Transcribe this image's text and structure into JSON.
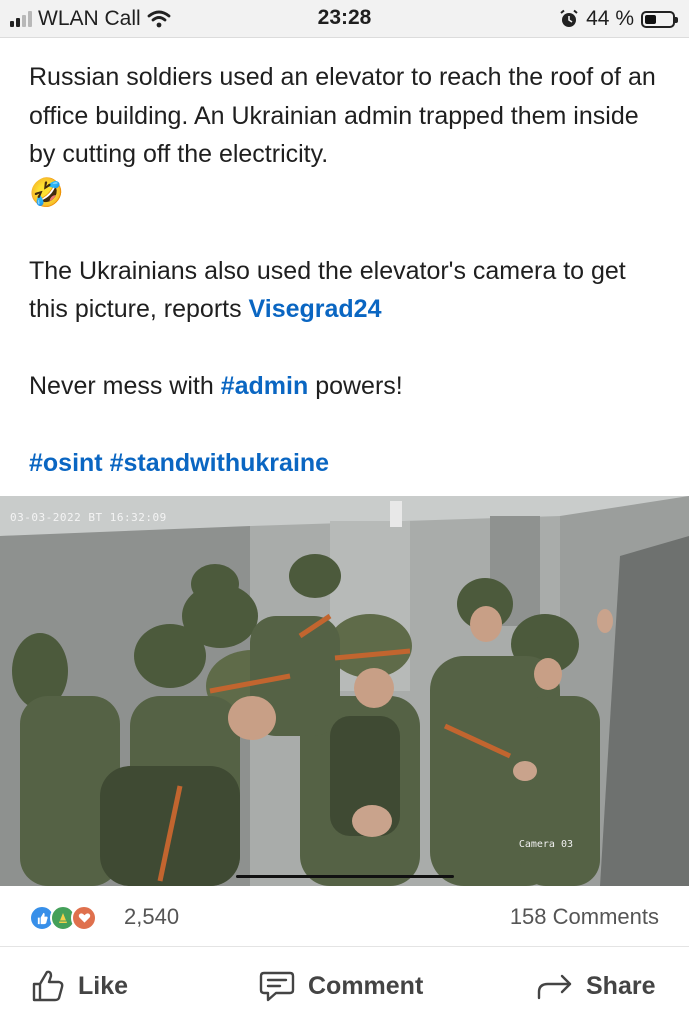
{
  "status_bar": {
    "carrier": "WLAN Call",
    "time": "23:28",
    "battery_percent": "44 %",
    "battery_level": 0.44,
    "signal_bars_active": 2,
    "icons": [
      "signal-icon",
      "wifi-icon",
      "alarm-icon",
      "battery-icon"
    ]
  },
  "post": {
    "paragraph_1": "Russian soldiers used an elevator to reach the roof of an office building. An Ukrainian admin trapped them inside by cutting off the electricity.",
    "emoji_1": "🤣",
    "paragraph_2_before": "The Ukrainians also used the elevator's camera to get this picture, reports ",
    "mention": "Visegrad24",
    "paragraph_3_before": "Never mess with ",
    "hashtag_admin": "#admin",
    "paragraph_3_after": " powers!",
    "hashtags": "#osint #standwithukraine",
    "flag_icon": "ukraine-flag-icon",
    "link_color": "#0a66c2"
  },
  "image": {
    "timestamp": "03-03-2022 ВТ 16:32:09",
    "camera_label": "Camera 03"
  },
  "social": {
    "reactions": [
      "like",
      "celebrate",
      "love"
    ],
    "reaction_count": "2,540",
    "comments": "158 Comments"
  },
  "actions": {
    "like": "Like",
    "comment": "Comment",
    "share": "Share"
  }
}
